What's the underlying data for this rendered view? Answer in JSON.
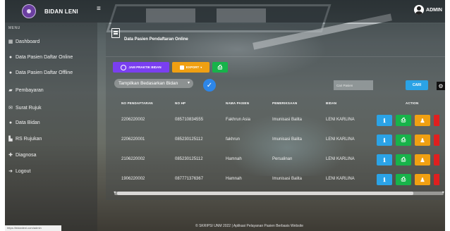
{
  "header": {
    "brand": "BIDAN LENI",
    "admin_label": "ADMIN"
  },
  "sidebar": {
    "title": "MENU",
    "items": [
      {
        "label": "Dashboard",
        "icon": "dashboard-icon"
      },
      {
        "label": "Data Pasien Daftar Online",
        "icon": "user-icon"
      },
      {
        "label": "Data Pasien Daftar Offline",
        "icon": "user-icon"
      },
      {
        "label": "Pembayaran",
        "icon": "money-icon"
      },
      {
        "label": "Surat Rujuk",
        "icon": "mail-icon"
      },
      {
        "label": "Data Bidan",
        "icon": "user-icon"
      },
      {
        "label": "RS Rujukan",
        "icon": "hospital-icon"
      },
      {
        "label": "Diagnosa",
        "icon": "stethoscope-icon"
      },
      {
        "label": "Logout",
        "icon": "logout-icon"
      }
    ]
  },
  "main": {
    "title": "Data Pasien Pendaftaran Online",
    "toolbar": {
      "jam_praktik_label": "JAM PRAKTIK BIDAN",
      "export_label": "EXPORT",
      "print_icon": "printer-icon"
    },
    "filter": {
      "select_value": "Tampilkan Bedasarkan Bidan",
      "search_placeholder": "Cari Pasien",
      "search_button": "CARI"
    },
    "table": {
      "columns": [
        "NO PENDAFTARAN",
        "NO HP",
        "NAMA PASIEN",
        "PEMERIKSAAN",
        "BIDAN",
        "ACTION"
      ],
      "rows": [
        [
          "2206220002",
          "085710834555",
          "Fakhrun Asia",
          "Imunisasi Balita",
          "LENI KARLINA"
        ],
        [
          "2206220001",
          "085230125112",
          "fakhrun",
          "Imunisasi Balita",
          "LENI KARLINA"
        ],
        [
          "2106220002",
          "085230125112",
          "Hamnah",
          "Persalinan",
          "LENI KARLINA"
        ],
        [
          "1906220002",
          "087771376367",
          "Hamnah",
          "Imunisasi Balita",
          "LENI KARLINA"
        ]
      ]
    }
  },
  "footer": "© SKRIPSI UNM 2022 | Aplikasi Pelayanan Pasien Berbasis Website",
  "status_url": "https://bidanleni.com/admin"
}
